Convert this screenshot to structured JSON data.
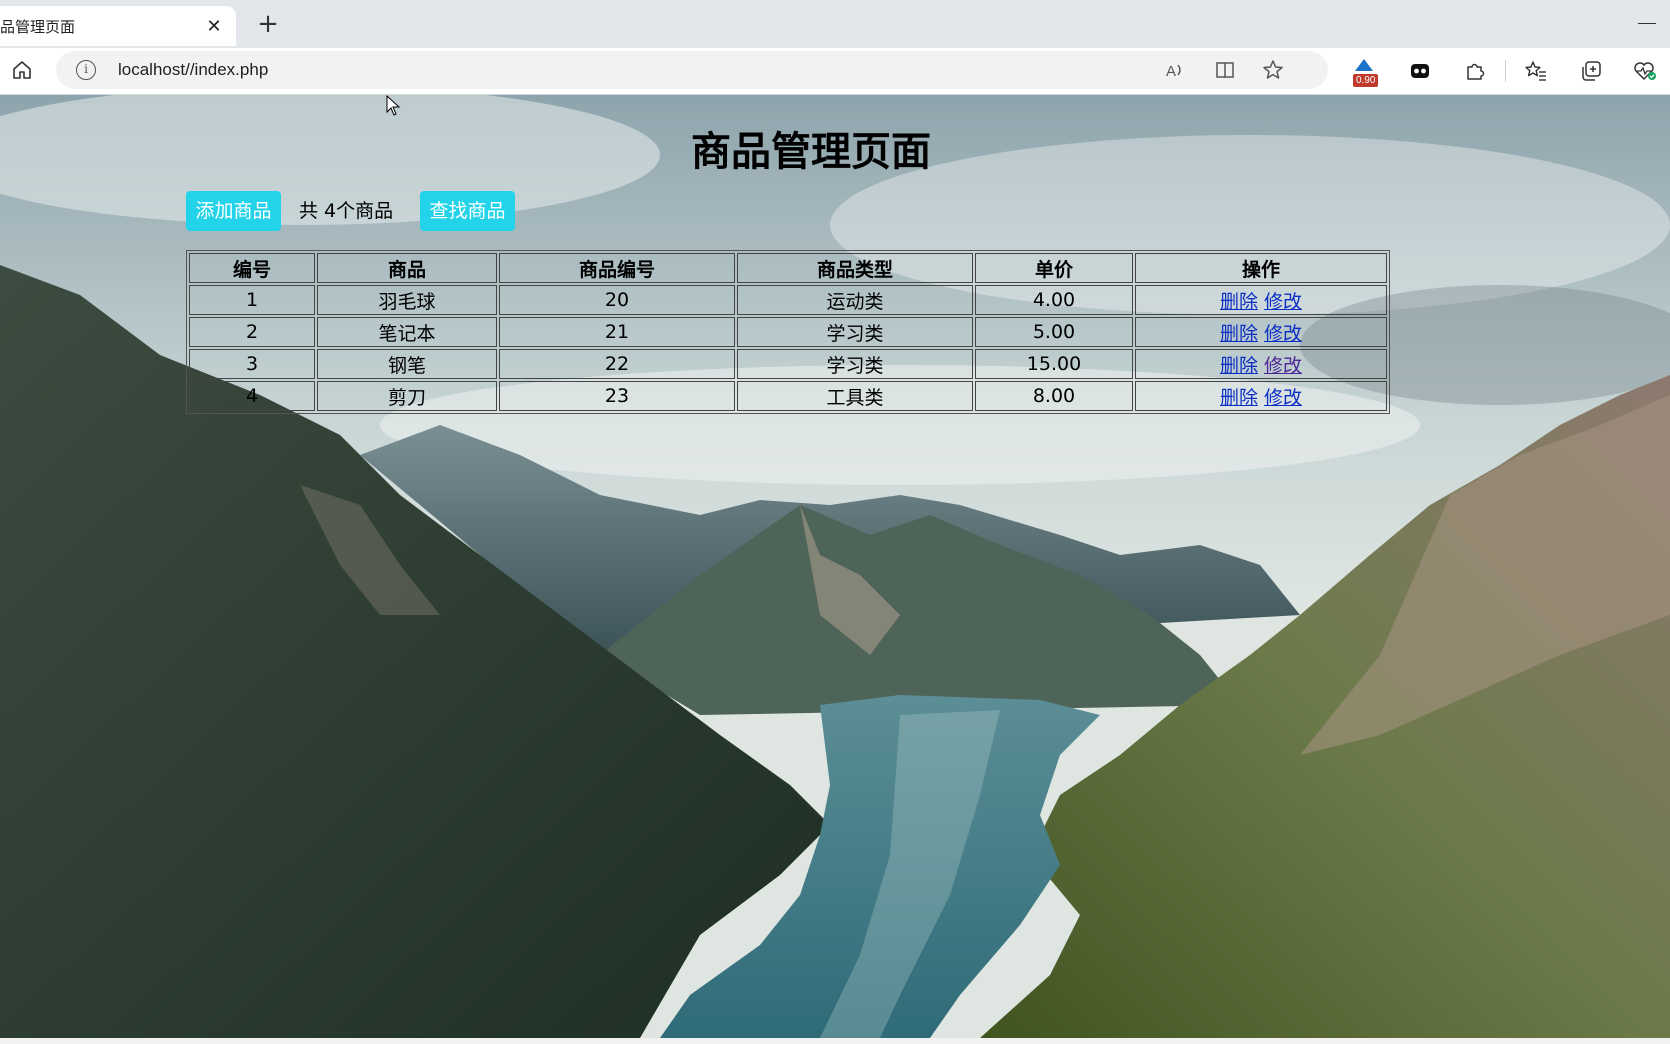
{
  "browser": {
    "tab_title": "品管理页面",
    "tab_close_glyph": "✕",
    "new_tab_glyph": "+",
    "url": "localhost//index.php",
    "extension_badge": "0.90"
  },
  "page": {
    "title": "商品管理页面",
    "add_button": "添加商品",
    "count_text": "共 4个商品",
    "search_button": "查找商品"
  },
  "table": {
    "headers": [
      "编号",
      "商品",
      "商品编号",
      "商品类型",
      "单价",
      "操作"
    ],
    "rows": [
      {
        "id": "1",
        "name": "羽毛球",
        "code": "20",
        "type": "运动类",
        "price": "4.00",
        "delete": "删除",
        "edit": "修改"
      },
      {
        "id": "2",
        "name": "笔记本",
        "code": "21",
        "type": "学习类",
        "price": "5.00",
        "delete": "删除",
        "edit": "修改"
      },
      {
        "id": "3",
        "name": "钢笔",
        "code": "22",
        "type": "学习类",
        "price": "15.00",
        "delete": "删除",
        "edit": "修改"
      },
      {
        "id": "4",
        "name": "剪刀",
        "code": "23",
        "type": "工具类",
        "price": "8.00",
        "delete": "删除",
        "edit": "修改"
      }
    ]
  },
  "colors": {
    "button_bg": "#23d3ea",
    "link": "#0b2fc4",
    "visited_link": "#4b2896"
  },
  "icons": [
    "home-icon",
    "info-icon",
    "read-aloud-icon",
    "split-screen-icon",
    "favorite-star-icon",
    "extension-icon",
    "puzzle-icon",
    "favorites-icon",
    "collections-icon",
    "health-icon"
  ]
}
